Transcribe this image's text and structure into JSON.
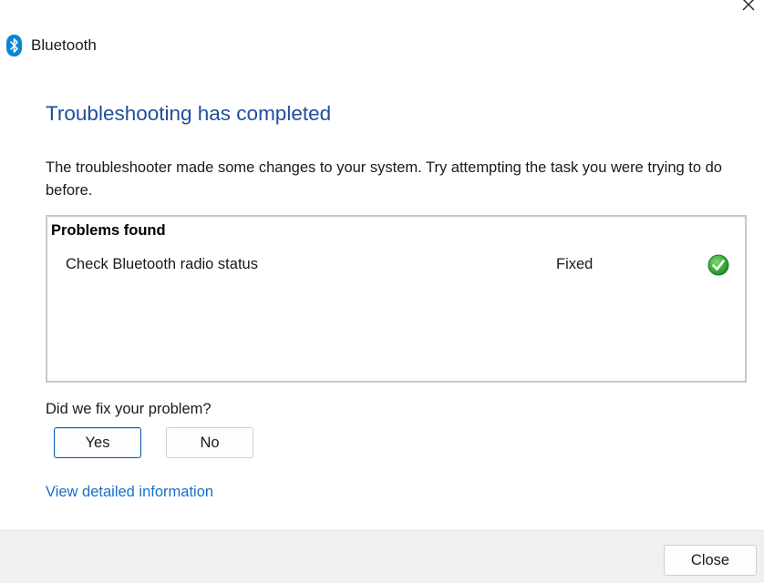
{
  "window": {
    "title": "Bluetooth"
  },
  "main": {
    "heading": "Troubleshooting has completed",
    "description": "The troubleshooter made some changes to your system. Try attempting the task you were trying to do before."
  },
  "problems": {
    "header": "Problems found",
    "items": [
      {
        "name": "Check Bluetooth radio status",
        "status": "Fixed",
        "status_icon": "green-checkmark-icon"
      }
    ]
  },
  "feedback": {
    "question": "Did we fix your problem?",
    "yes_label": "Yes",
    "no_label": "No"
  },
  "link": {
    "text": "View detailed information"
  },
  "footer": {
    "close_label": "Close"
  },
  "colors": {
    "heading": "#1f4e9e",
    "link": "#1a6fc7",
    "bluetooth_icon": "#0a84d8",
    "success": "#2ea43a"
  }
}
